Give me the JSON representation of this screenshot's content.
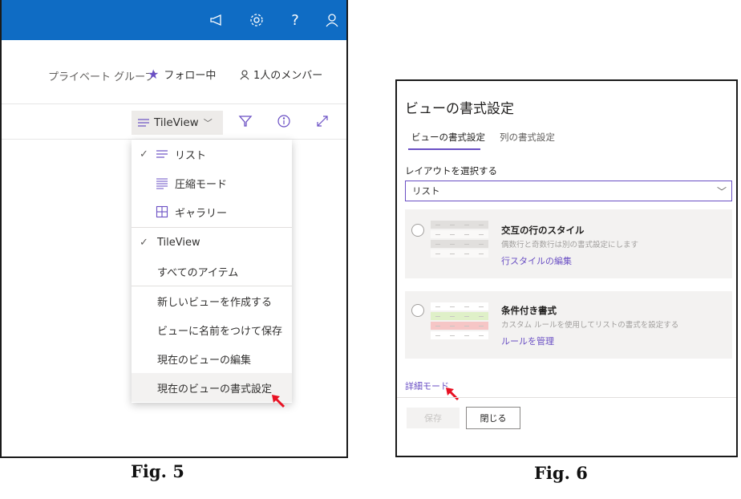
{
  "fig5": {
    "group_bar": {
      "private_group": "プライベート グループ",
      "follow_label": "フォロー中",
      "members_label": "1人のメンバー"
    },
    "view_switcher": {
      "label": "TileView"
    },
    "dropdown": {
      "items": [
        {
          "label": "リスト",
          "checked": true,
          "icon": "list-icon"
        },
        {
          "label": "圧縮モード",
          "checked": false,
          "icon": "compact-list-icon"
        },
        {
          "label": "ギャラリー",
          "checked": false,
          "icon": "gallery-icon"
        },
        {
          "label": "TileView",
          "checked": true
        },
        {
          "label": "すべてのアイテム",
          "checked": false
        },
        {
          "label": "新しいビューを作成する",
          "checked": false
        },
        {
          "label": "ビューに名前をつけて保存",
          "checked": false
        },
        {
          "label": "現在のビューの編集",
          "checked": false
        },
        {
          "label": "現在のビューの書式設定",
          "checked": false,
          "highlighted": true
        }
      ]
    },
    "caption": "Fig. 5"
  },
  "fig6": {
    "title": "ビューの書式設定",
    "tabs": [
      {
        "label": "ビューの書式設定",
        "active": true
      },
      {
        "label": "列の書式設定",
        "active": false
      }
    ],
    "layout_label": "レイアウトを選択する",
    "layout_value": "リスト",
    "cards": [
      {
        "title": "交互の行のスタイル",
        "description": "偶数行と奇数行は別の書式設定にします",
        "link": "行スタイルの編集"
      },
      {
        "title": "条件付き書式",
        "description": "カスタム ルールを使用してリストの書式を設定する",
        "link": "ルールを管理"
      }
    ],
    "advanced_link": "詳細モード",
    "save_button": "保存",
    "close_button": "閉じる",
    "caption": "Fig. 6"
  },
  "colors": {
    "suite_bar": "#0f6cc4",
    "accent": "#6a4fc4",
    "arrow": "#e81123",
    "highlight_green": "#dff0c8",
    "highlight_red": "#f6c6c6"
  }
}
